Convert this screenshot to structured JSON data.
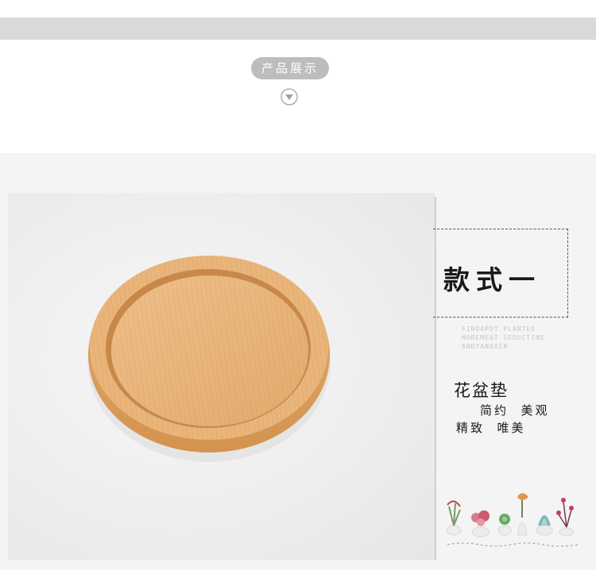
{
  "header": {
    "section_title": "产品展示",
    "icon": "chevron-down-circle-icon"
  },
  "product": {
    "style_label": "款式一",
    "english_lines": [
      "FINDAPOT PLANTED",
      "MOREMEAT SEDUCTINE",
      "ANDYANQXIN"
    ],
    "name": "花盆垫",
    "desc_line1": "简约  美观",
    "desc_line2": "精致  唯美",
    "photo_subject": "round bamboo plant pot saucer",
    "illustration": "potted succulents and flowers decoration"
  },
  "colors": {
    "bar": "#d9d9d9",
    "pill": "#bdbdbd",
    "section_bg": "#f4f4f4",
    "wood_light": "#e8b67c",
    "wood_dark": "#d79a5a",
    "text": "#1a1a1a"
  }
}
